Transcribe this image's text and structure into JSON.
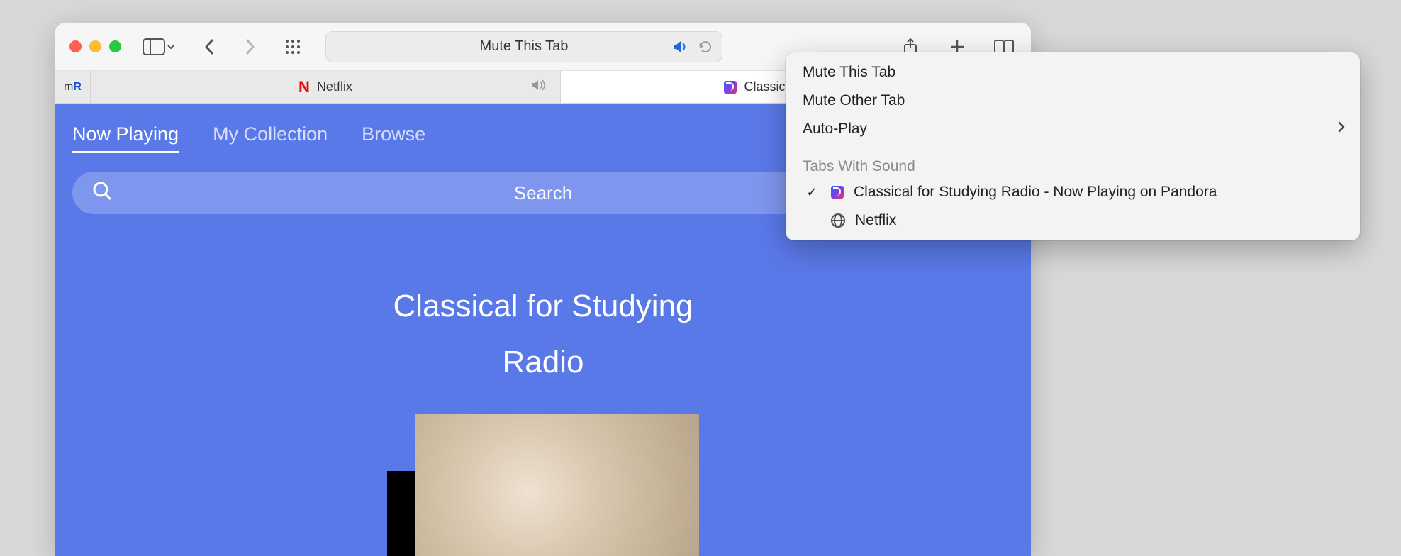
{
  "window": {
    "address_label": "Mute This Tab"
  },
  "tabs": {
    "fav_label_m": "m",
    "fav_label_r": "R",
    "netflix_label": "Netflix",
    "pandora_label": "Classical for Studying"
  },
  "page": {
    "nav_now_playing": "Now Playing",
    "nav_my_collection": "My Collection",
    "nav_browse": "Browse",
    "search_placeholder": "Search",
    "station_line1": "Classical for Studying",
    "station_line2": "Radio"
  },
  "menu": {
    "mute_this": "Mute This Tab",
    "mute_other": "Mute Other Tab",
    "autoplay": "Auto-Play",
    "section_header": "Tabs With Sound",
    "sound_tab_pandora": "Classical for Studying Radio - Now Playing on Pandora",
    "sound_tab_netflix": "Netflix"
  }
}
